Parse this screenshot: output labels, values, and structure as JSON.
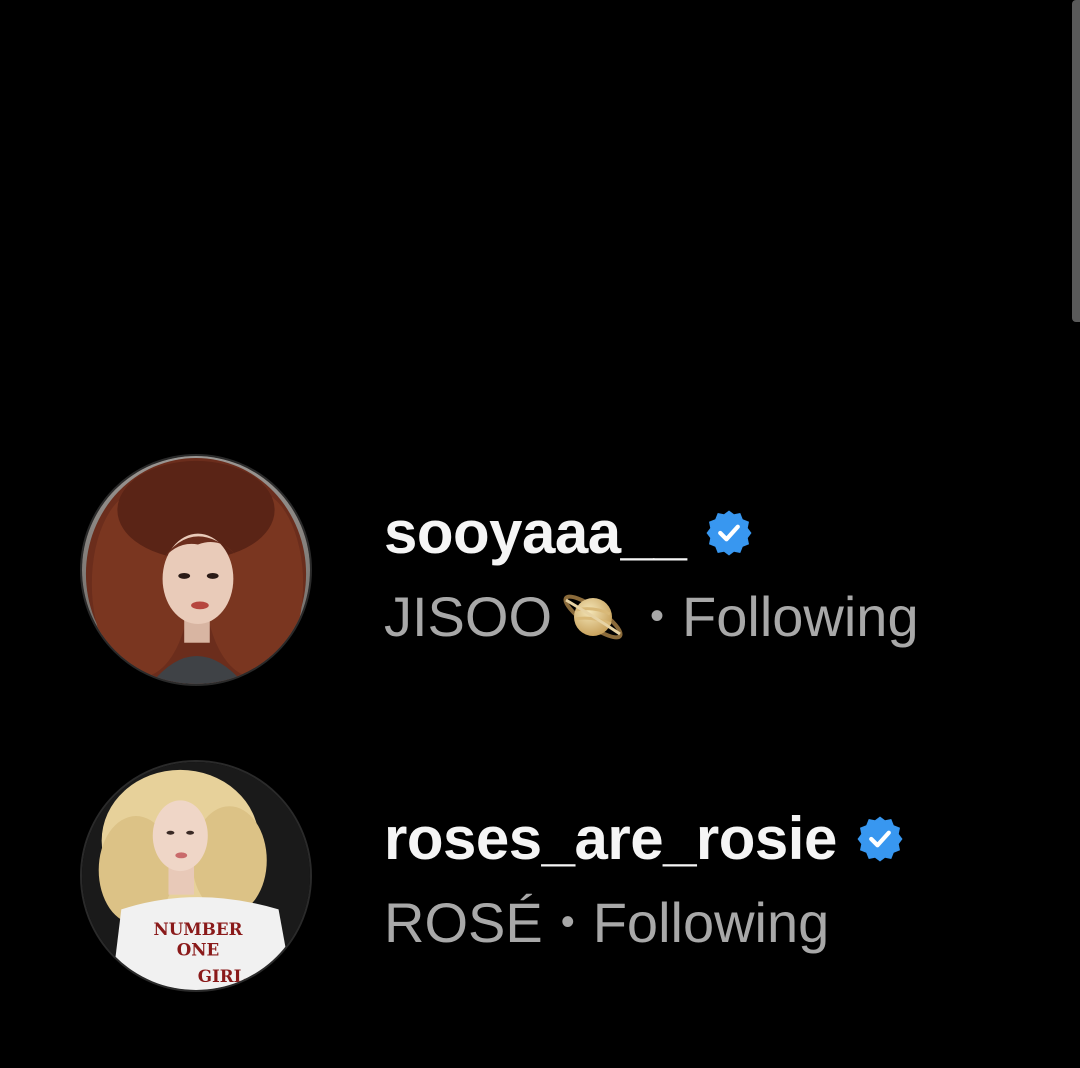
{
  "accounts": [
    {
      "username": "sooyaaa__",
      "display_name": "JISOO",
      "display_emoji": "saturn-emoji",
      "separator": "•",
      "status": "Following",
      "verified": true
    },
    {
      "username": "roses_are_rosie",
      "display_name": "ROSÉ",
      "separator": "•",
      "status": "Following",
      "verified": true,
      "avatar_shirt_text": [
        "NUMBER",
        "ONE",
        "GIRL"
      ]
    }
  ],
  "colors": {
    "background": "#000000",
    "username": "#f5f5f5",
    "secondary_text": "#a8a8a8",
    "verified_badge": "#3897f0"
  }
}
